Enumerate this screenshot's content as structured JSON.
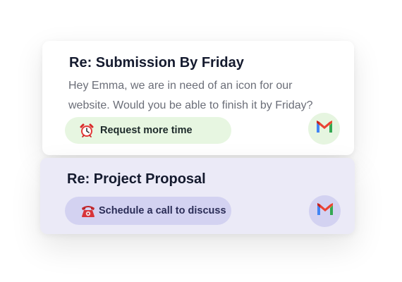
{
  "cards": [
    {
      "title": "Re: Submission By Friday",
      "body": "Hey Emma, we are in need of an icon for our website. Would you be able to finish it by Friday?",
      "action": {
        "label": "Request more time",
        "icon": "alarm-clock-icon",
        "background": "#e7f6e1"
      },
      "mail_icon": "gmail-icon"
    },
    {
      "title": "Re: Project Proposal",
      "action": {
        "label": "Schedule a call to discuss",
        "icon": "telephone-icon",
        "background": "#d3d2f1"
      },
      "background": "#ebeaf7",
      "mail_icon": "gmail-icon"
    }
  ]
}
